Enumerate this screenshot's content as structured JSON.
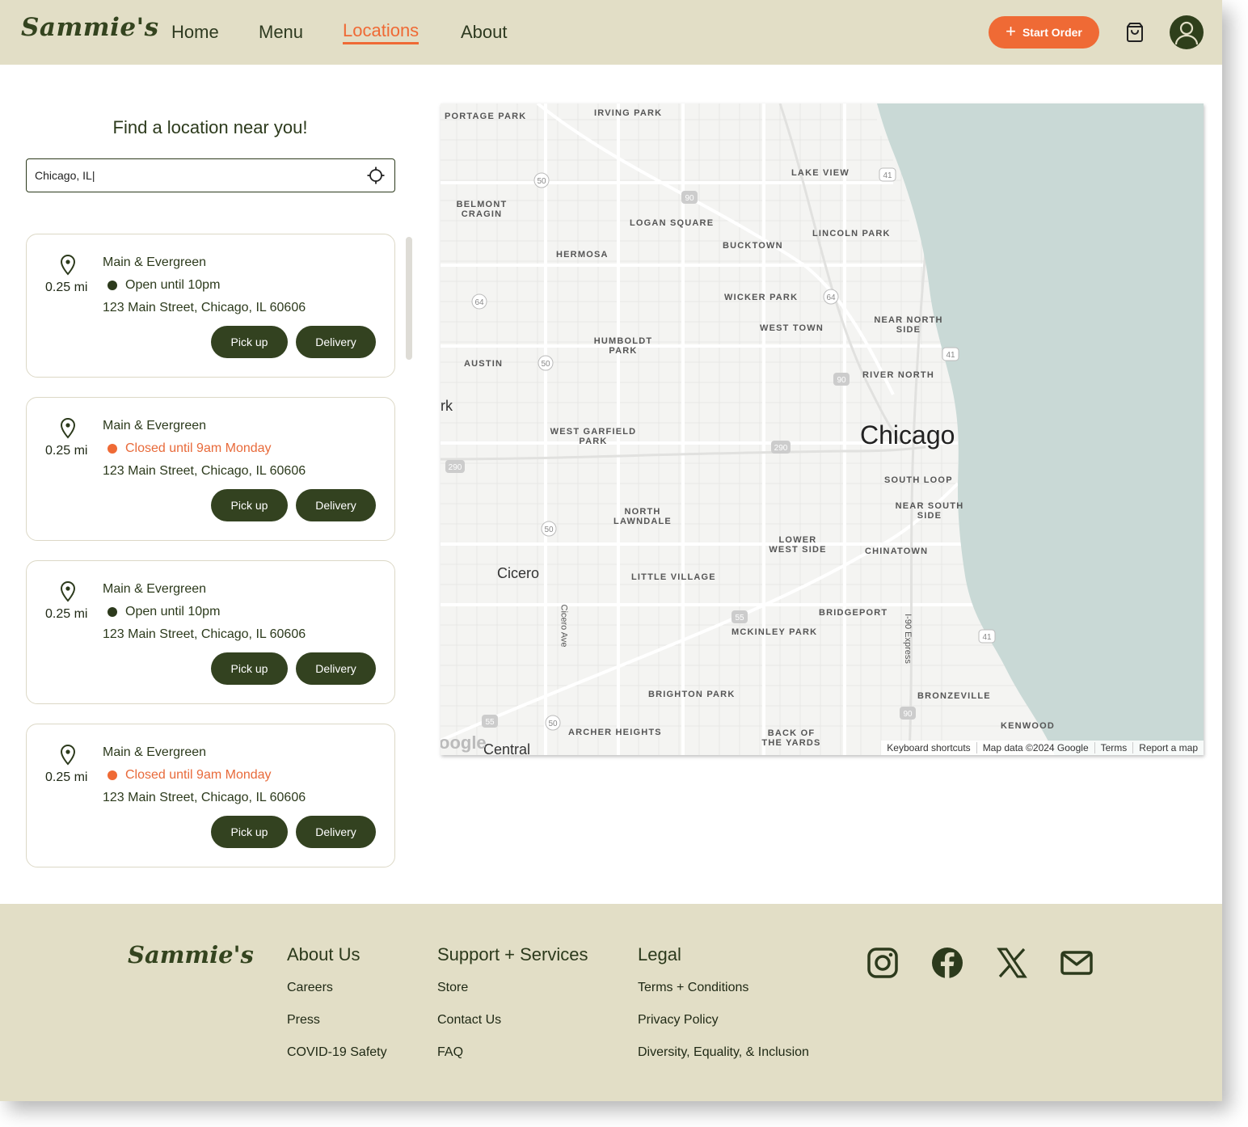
{
  "brand": "Sammie's",
  "nav": {
    "items": [
      "Home",
      "Menu",
      "Locations",
      "About"
    ],
    "active": "Locations",
    "start_order": "Start Order"
  },
  "search": {
    "title": "Find a location near you!",
    "value": "Chicago, IL|"
  },
  "locations": [
    {
      "name": "Main & Evergreen",
      "distance": "0.25 mi",
      "status": "Open until 10pm",
      "state": "open",
      "address": "123 Main Street, Chicago, IL 60606",
      "pickup": "Pick up",
      "delivery": "Delivery"
    },
    {
      "name": "Main & Evergreen",
      "distance": "0.25 mi",
      "status": "Closed until 9am Monday",
      "state": "closed",
      "address": "123 Main Street, Chicago, IL 60606",
      "pickup": "Pick up",
      "delivery": "Delivery"
    },
    {
      "name": "Main & Evergreen",
      "distance": "0.25 mi",
      "status": "Open until 10pm",
      "state": "open",
      "address": "123 Main Street, Chicago, IL 60606",
      "pickup": "Pick up",
      "delivery": "Delivery"
    },
    {
      "name": "Main & Evergreen",
      "distance": "0.25 mi",
      "status": "Closed until 9am Monday",
      "state": "closed",
      "address": "123 Main Street, Chicago, IL 60606",
      "pickup": "Pick up",
      "delivery": "Delivery"
    }
  ],
  "map": {
    "city": "Chicago",
    "suburbs": [
      "Cicero",
      "Central",
      "rk"
    ],
    "neighborhoods": [
      "PORTAGE PARK",
      "IRVING PARK",
      "LAKE VIEW",
      "BELMONT CRAGIN",
      "LOGAN SQUARE",
      "LINCOLN PARK",
      "BUCKTOWN",
      "HERMOSA",
      "WICKER PARK",
      "NEAR NORTH SIDE",
      "WEST TOWN",
      "HUMBOLDT PARK",
      "AUSTIN",
      "RIVER NORTH",
      "WEST GARFIELD PARK",
      "SOUTH LOOP",
      "NORTH LAWNDALE",
      "NEAR SOUTH SIDE",
      "LOWER WEST SIDE",
      "CHINATOWN",
      "LITTLE VILLAGE",
      "BRIDGEPORT",
      "MCKINLEY PARK",
      "BRIGHTON PARK",
      "BRONZEVILLE",
      "KENWOOD",
      "ARCHER HEIGHTS",
      "BACK OF THE YARDS"
    ],
    "roads": [
      "Cicero Ave",
      "I-90 Express"
    ],
    "shields": [
      "50",
      "90",
      "41",
      "64",
      "290",
      "55"
    ],
    "attribution": [
      "Keyboard shortcuts",
      "Map data ©2024 Google",
      "Terms",
      "Report a map"
    ],
    "colors": {
      "water": "#c9d9d6",
      "land": "#f4f4f2",
      "roads": "#ffffff"
    }
  },
  "footer": {
    "brand": "Sammie's",
    "columns": [
      {
        "title": "About Us",
        "links": [
          "Careers",
          "Press",
          "COVID-19 Safety"
        ]
      },
      {
        "title": "Support + Services",
        "links": [
          "Store",
          "Contact Us",
          "FAQ"
        ]
      },
      {
        "title": "Legal",
        "links": [
          "Terms + Conditions",
          "Privacy Policy",
          "Diversity, Equality, & Inclusion"
        ]
      }
    ],
    "social": [
      "instagram-icon",
      "facebook-icon",
      "x-icon",
      "mail-icon"
    ]
  },
  "colors": {
    "accent": "#ef6a35",
    "primary": "#334220",
    "header_bg": "#e2dec6"
  }
}
